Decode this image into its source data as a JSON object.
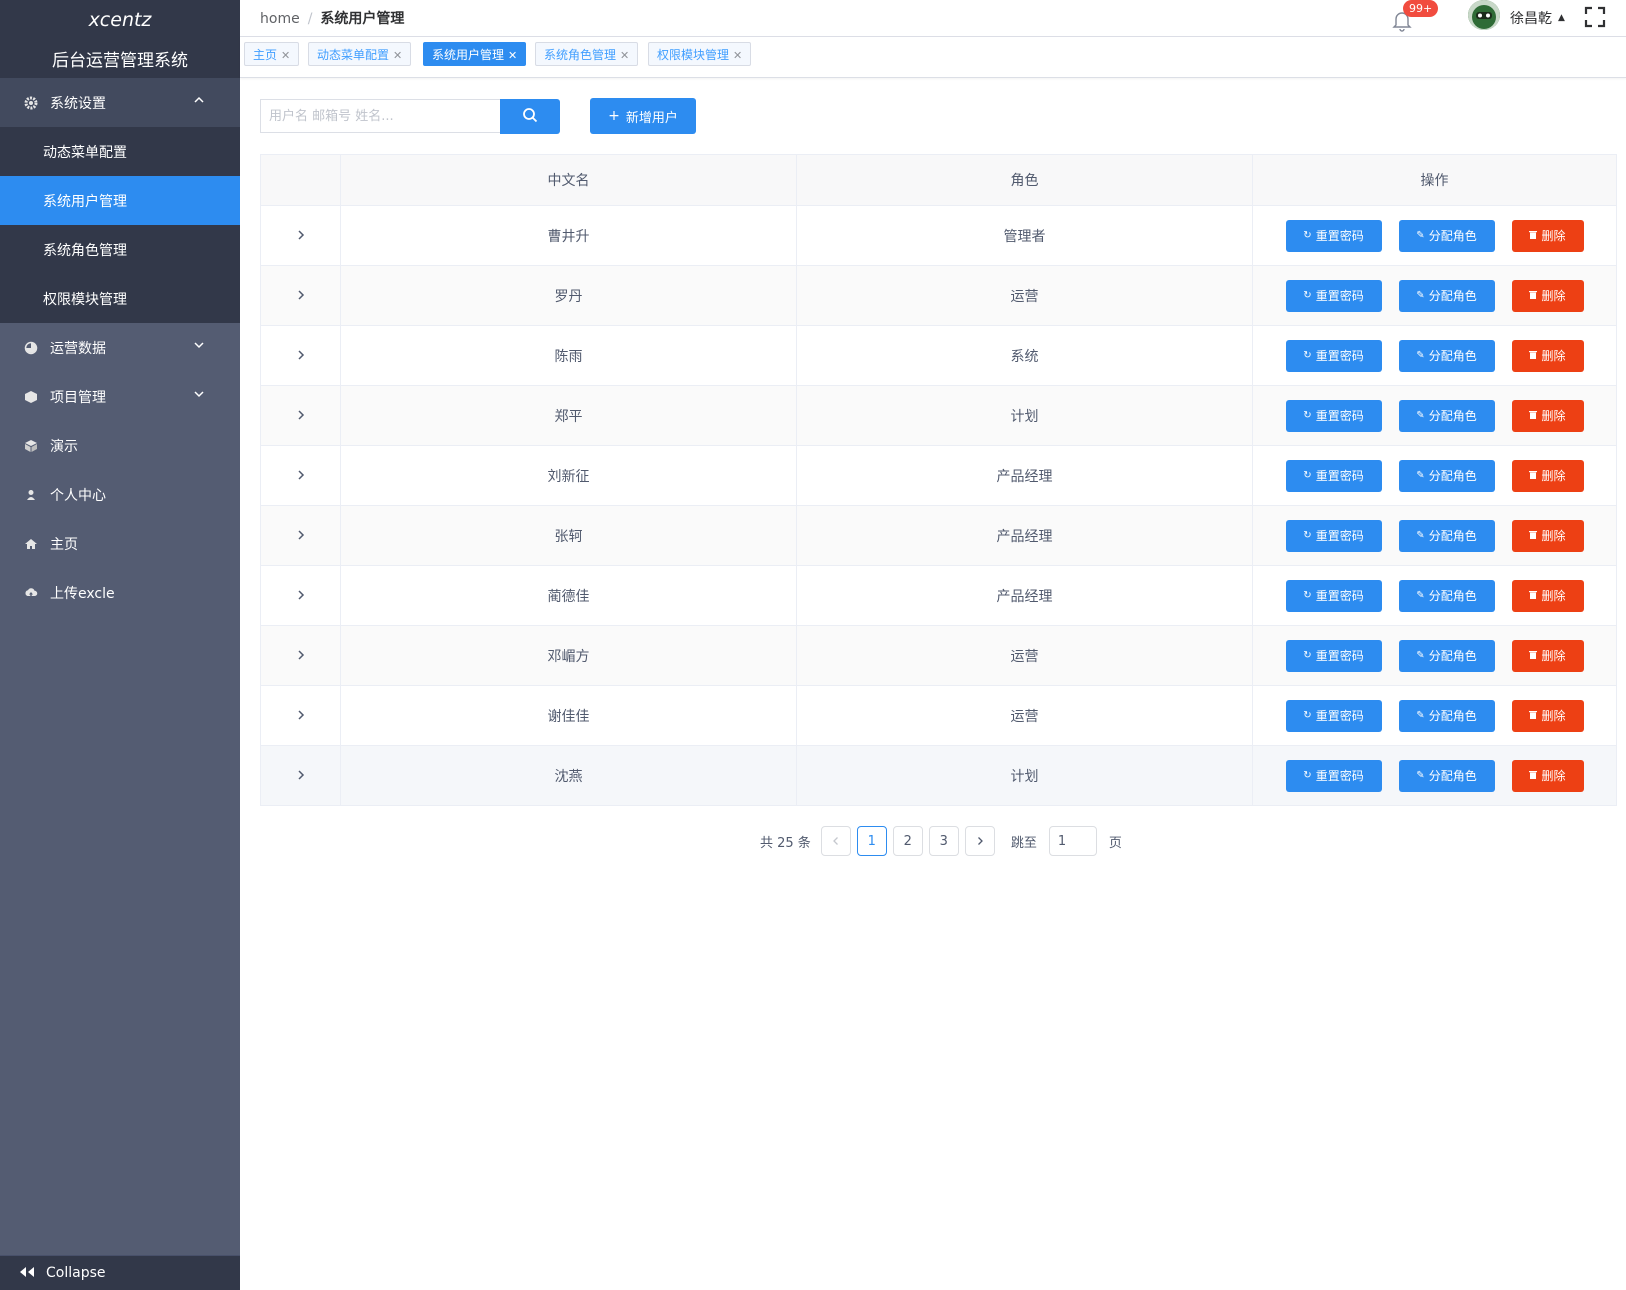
{
  "sidebar": {
    "logo": "xcentz",
    "system_name": "后台运营管理系统",
    "menus": [
      {
        "label": "系统设置",
        "icon": "gear-icon",
        "expanded": true
      },
      {
        "label": "运营数据",
        "icon": "pie-chart-icon",
        "expanded": false
      },
      {
        "label": "项目管理",
        "icon": "cube-icon",
        "expanded": false
      },
      {
        "label": "演示",
        "icon": "cube-icon"
      },
      {
        "label": "个人中心",
        "icon": "user-icon"
      },
      {
        "label": "主页",
        "icon": "home-icon"
      },
      {
        "label": "上传excle",
        "icon": "cloud-upload-icon"
      }
    ],
    "submenu": [
      {
        "label": "动态菜单配置",
        "active": false
      },
      {
        "label": "系统用户管理",
        "active": true
      },
      {
        "label": "系统角色管理",
        "active": false
      },
      {
        "label": "权限模块管理",
        "active": false
      }
    ],
    "collapse_label": "Collapse"
  },
  "header": {
    "breadcrumb": [
      "home",
      "系统用户管理"
    ],
    "notification_badge": "99+",
    "username": "徐昌乾"
  },
  "tags": [
    {
      "label": "主页",
      "active": false
    },
    {
      "label": "动态菜单配置",
      "active": false
    },
    {
      "label": "系统用户管理",
      "active": true
    },
    {
      "label": "系统角色管理",
      "active": false
    },
    {
      "label": "权限模块管理",
      "active": false
    }
  ],
  "toolbar": {
    "search_placeholder": "用户名 邮箱号 姓名...",
    "add_label": "新增用户"
  },
  "table": {
    "columns": [
      "",
      "中文名",
      "角色",
      "操作"
    ],
    "rows": [
      {
        "name": "曹井升",
        "role": "管理者"
      },
      {
        "name": "罗丹",
        "role": "运营"
      },
      {
        "name": "陈雨",
        "role": "系统"
      },
      {
        "name": "郑平",
        "role": "计划"
      },
      {
        "name": "刘新征",
        "role": "产品经理"
      },
      {
        "name": "张轲",
        "role": "产品经理"
      },
      {
        "name": "蔺德佳",
        "role": "产品经理"
      },
      {
        "name": "邓嵋方",
        "role": "运营"
      },
      {
        "name": "谢佳佳",
        "role": "运营"
      },
      {
        "name": "沈燕",
        "role": "计划"
      }
    ],
    "actions": {
      "reset": "重置密码",
      "assign": "分配角色",
      "delete": "删除"
    }
  },
  "pagination": {
    "total_text": "共 25 条",
    "pages": [
      "1",
      "2",
      "3"
    ],
    "current": "1",
    "jump_label": "跳至",
    "jump_value": "1",
    "page_suffix": "页"
  },
  "colors": {
    "primary": "#2d8cf0",
    "danger": "#ed4014",
    "sidebar": "#545c72",
    "sidebar_dark": "#323849"
  }
}
